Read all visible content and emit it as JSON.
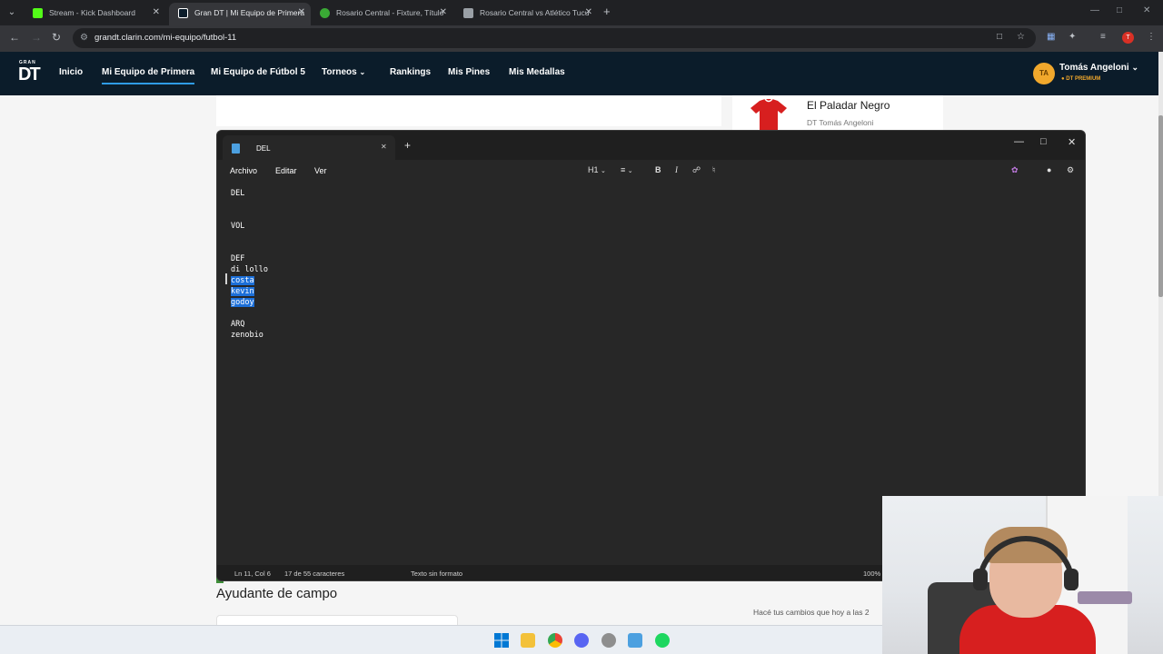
{
  "browser": {
    "tabs": [
      {
        "label": "Stream - Kick Dashboard",
        "favicon_color": "#53fc18"
      },
      {
        "label": "Gran DT | Mi Equipo de Primera",
        "favicon_color": "#0b1c2a"
      },
      {
        "label": "Rosario Central - Fixture, Título",
        "favicon_color": "#3aa935"
      },
      {
        "label": "Rosario Central vs Atlético Tucu",
        "favicon_color": "#9aa0a6"
      }
    ],
    "url": "grandt.clarin.com/mi-equipo/futbol-11",
    "profile_initial": "T"
  },
  "site": {
    "logo_small": "GRAN",
    "logo_big": "DT",
    "nav": [
      {
        "label": "Inicio"
      },
      {
        "label": "Mi Equipo de Primera"
      },
      {
        "label": "Mi Equipo de Fútbol 5"
      },
      {
        "label": "Torneos"
      },
      {
        "label": "Rankings"
      },
      {
        "label": "Mis Pines"
      },
      {
        "label": "Mis Medallas"
      }
    ],
    "user": {
      "initials": "TA",
      "name": "Tomás Angeloni",
      "plan": "DT PREMIUM"
    },
    "team_name": "El Paladar Negro",
    "team_dt": "DT Tomás Angeloni",
    "section_title": "Ayudante de campo",
    "right_text": "Hacé tus cambios que hoy a las 2"
  },
  "notepad": {
    "tab_title": "DEL",
    "menus": [
      "Archivo",
      "Editar",
      "Ver"
    ],
    "heading_label": "H1",
    "lines": [
      {
        "text": "DEL"
      },
      {
        "text": ""
      },
      {
        "text": ""
      },
      {
        "text": "VOL"
      },
      {
        "text": ""
      },
      {
        "text": ""
      },
      {
        "text": "DEF"
      },
      {
        "text": "di lollo"
      },
      {
        "text": "costa",
        "selected": true
      },
      {
        "text": "kevin",
        "selected": true
      },
      {
        "text": "godoy",
        "selected": true
      },
      {
        "text": ""
      },
      {
        "text": "ARQ"
      },
      {
        "text": "zenobio"
      }
    ],
    "status": {
      "position": "Ln 11, Col 6",
      "selection": "17 de 55 caracteres",
      "format": "Texto sin formato",
      "zoom": "100%"
    }
  },
  "colors": {
    "site_nav_bg": "#0b1c2a",
    "accent": "#2f9be5",
    "selection": "#1c6fd8",
    "premium": "#f1a82c"
  }
}
